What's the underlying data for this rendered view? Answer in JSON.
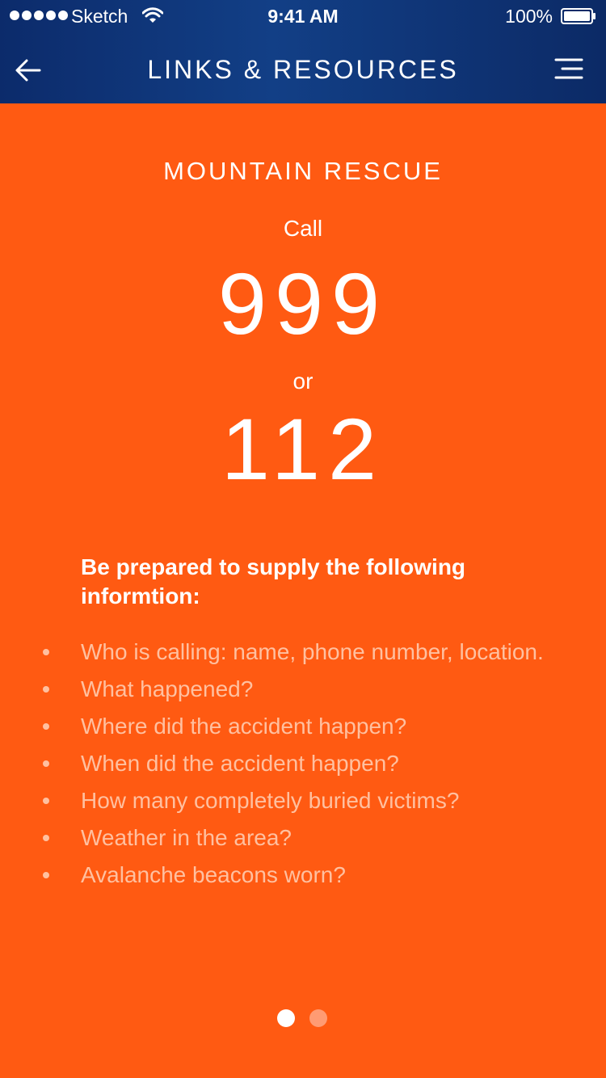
{
  "status_bar": {
    "carrier": "Sketch",
    "time": "9:41 AM",
    "battery": "100%"
  },
  "nav": {
    "title": "LINKS & RESOURCES",
    "back_icon": "back-arrow-icon",
    "menu_icon": "hamburger-menu-icon"
  },
  "content": {
    "section_title": "MOUNTAIN RESCUE",
    "call_label": "Call",
    "primary_number": "999",
    "or_label": "or",
    "secondary_number": "112",
    "prep_heading": "Be prepared to supply the following informtion:",
    "items": [
      "Who is calling: name, phone number, location.",
      "What happened?",
      "Where did the accident happen?",
      "When did the accident happen?",
      "How many completely buried victims?",
      "Weather in the area?",
      "Avalanche beacons worn?"
    ]
  },
  "pager": {
    "current_page": 1,
    "total_pages": 2
  },
  "colors": {
    "header": "#123f86",
    "background": "#ff5a12",
    "text": "#ffffff",
    "muted_text": "#ffc0a0",
    "inactive_dot": "#ff9b73"
  }
}
